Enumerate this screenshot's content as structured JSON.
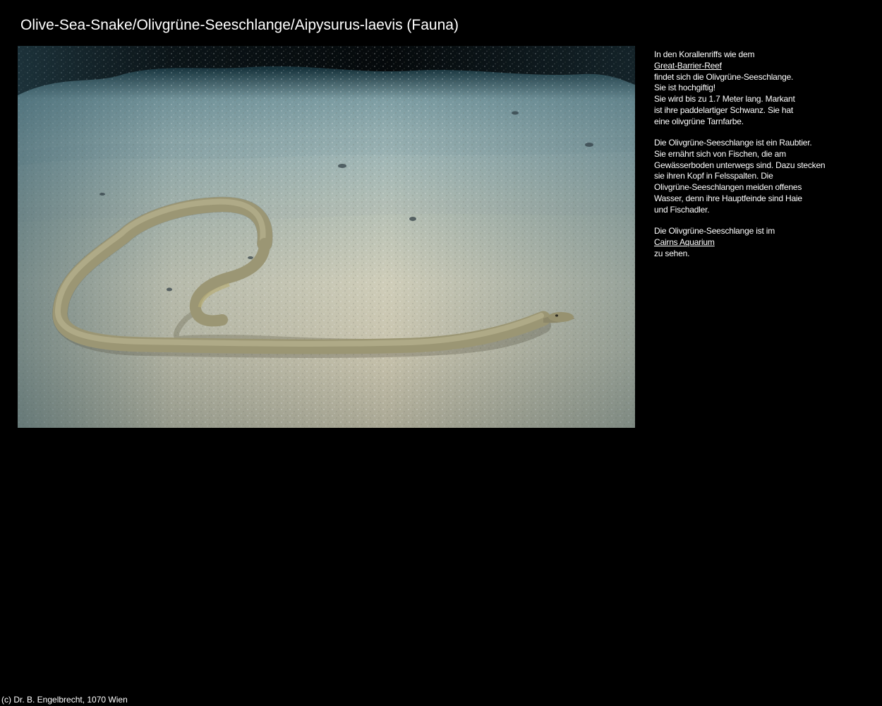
{
  "page": {
    "title": "Olive-Sea-Snake/Olivgrüne-Seeschlange/Aipysurus-laevis (Fauna)"
  },
  "photo": {
    "subject": "olive sea snake on sandy aquarium floor"
  },
  "description": {
    "p1": {
      "line1": "In den Korallenriffs wie dem",
      "link": "Great-Barrier-Reef",
      "line3": "findet sich die Olivgrüne-Seeschlange.",
      "line4": "Sie ist hochgiftig!",
      "line5": "Sie wird bis zu 1.7 Meter lang. Markant",
      "line6": "ist ihre paddelartiger Schwanz. Sie hat",
      "line7": "eine olivgrüne Tarnfarbe."
    },
    "p2": {
      "line1": "Die Olivgrüne-Seeschlange ist ein Raubtier.",
      "line2": "Sie ernährt sich von Fischen, die am",
      "line3": "Gewässerboden unterwegs sind. Dazu stecken",
      "line4": "sie ihren Kopf in Felsspalten. Die",
      "line5": "Olivgrüne-Seeschlangen meiden offenes",
      "line6": "Wasser, denn ihre Hauptfeinde sind Haie",
      "line7": "und Fischadler."
    },
    "p3": {
      "line1": "Die Olivgrüne-Seeschlange ist im",
      "link": "Cairns Aquarium",
      "line3": "zu sehen."
    }
  },
  "footer": {
    "copyright": "(c) Dr. B. Engelbrecht, 1070 Wien"
  },
  "colors": {
    "background": "#000000",
    "text": "#ffffff",
    "sand_light": "#d8d6c4",
    "water": "#3f6a78",
    "snake": "#a09a74"
  }
}
